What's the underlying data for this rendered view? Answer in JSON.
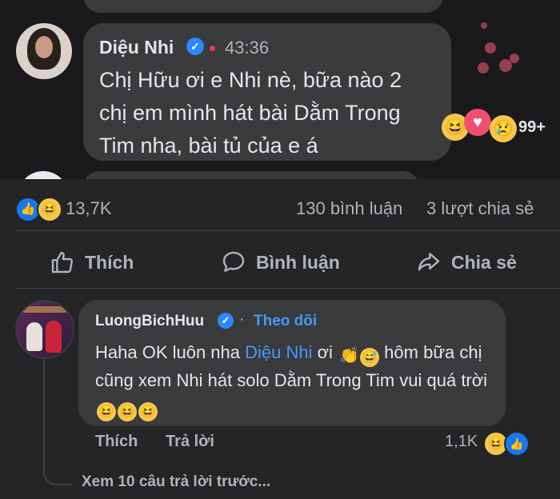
{
  "live_comment": {
    "name": "Diệu Nhi",
    "time": "43:36",
    "text": "Chị Hữu ơi e Nhi nè, bữa nào 2 chị em mình hát bài Dằm Trong Tim nha, bài tủ của e á",
    "reaction_count": "99+"
  },
  "stats": {
    "reaction_total": "13,7K",
    "comments": "130 bình luận",
    "shares": "3 lượt chia sẻ"
  },
  "actions": {
    "like": "Thích",
    "comment": "Bình luận",
    "share": "Chia sẻ"
  },
  "comment": {
    "name": "LuongBichHuu",
    "dot": "·",
    "follow": "Theo dõi",
    "text_part1": "Haha OK luôn nha ",
    "mention": "Diệu Nhi",
    "text_part2": " ơi ",
    "text_part3": " hôm bữa chị cũng xem Nhi hát solo Dằm Trong Tim vui quá trời ",
    "like_label": "Thích",
    "reply_label": "Trả lời",
    "reaction_count": "1,1K",
    "view_more": "Xem 10 câu trả lời trước..."
  },
  "icons": {
    "verified": "verified-check-icon",
    "like": "thumbs-up-icon",
    "comment": "speech-bubble-icon",
    "share": "share-arrow-icon"
  },
  "colors": {
    "background": "#242526",
    "bubble": "#3a3b3d",
    "link": "#4599ff",
    "like_blue": "#1877f2",
    "haha_yellow": "#f7c64a"
  }
}
